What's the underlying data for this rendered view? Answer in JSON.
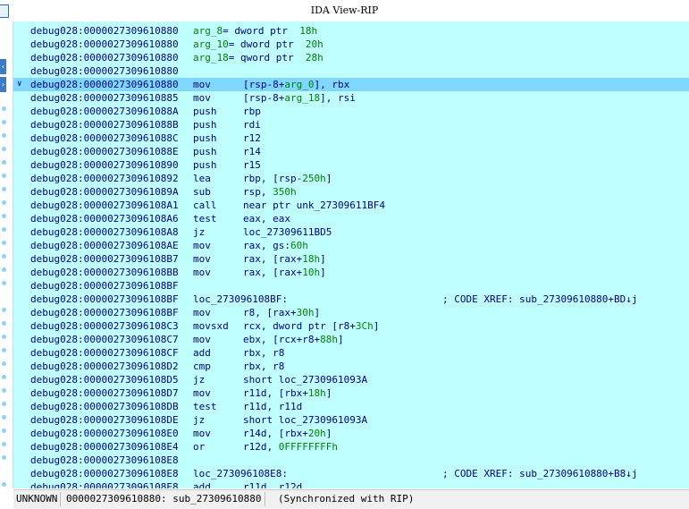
{
  "window": {
    "title": "IDA View-RIP"
  },
  "listing": {
    "rows": [
      {
        "addr": "debug028:0000027309610880",
        "kind": "var",
        "name": "arg_8",
        "eq": "= dword ptr  ",
        "val": "18h"
      },
      {
        "addr": "debug028:0000027309610880",
        "kind": "var",
        "name": "arg_10",
        "eq": "= dword ptr  ",
        "val": "20h"
      },
      {
        "addr": "debug028:0000027309610880",
        "kind": "var",
        "name": "arg_18",
        "eq": "= qword ptr  ",
        "val": "28h"
      },
      {
        "addr": "debug028:0000027309610880",
        "kind": "blank"
      },
      {
        "addr": "debug028:0000027309610880",
        "kind": "ins",
        "mnem": "mov",
        "ops": "[rsp-8+arg_0], rbx",
        "selected": true
      },
      {
        "addr": "debug028:0000027309610885",
        "kind": "ins",
        "mnem": "mov",
        "ops": "[rsp-8+arg_18], rsi"
      },
      {
        "addr": "debug028:000002730961088A",
        "kind": "ins",
        "mnem": "push",
        "ops": "rbp"
      },
      {
        "addr": "debug028:000002730961088B",
        "kind": "ins",
        "mnem": "push",
        "ops": "rdi"
      },
      {
        "addr": "debug028:000002730961088C",
        "kind": "ins",
        "mnem": "push",
        "ops": "r12"
      },
      {
        "addr": "debug028:000002730961088E",
        "kind": "ins",
        "mnem": "push",
        "ops": "r14"
      },
      {
        "addr": "debug028:0000027309610890",
        "kind": "ins",
        "mnem": "push",
        "ops": "r15"
      },
      {
        "addr": "debug028:0000027309610892",
        "kind": "ins",
        "mnem": "lea",
        "ops": "rbp, [rsp-250h]"
      },
      {
        "addr": "debug028:000002730961089A",
        "kind": "ins",
        "mnem": "sub",
        "ops": "rsp, 350h"
      },
      {
        "addr": "debug028:00000273096108A1",
        "kind": "ins",
        "mnem": "call",
        "ops": "near ptr unk_27309611BF4"
      },
      {
        "addr": "debug028:00000273096108A6",
        "kind": "ins",
        "mnem": "test",
        "ops": "eax, eax"
      },
      {
        "addr": "debug028:00000273096108A8",
        "kind": "ins",
        "mnem": "jz",
        "ops": "loc_27309611BD5"
      },
      {
        "addr": "debug028:00000273096108AE",
        "kind": "ins",
        "mnem": "mov",
        "ops": "rax, gs:60h"
      },
      {
        "addr": "debug028:00000273096108B7",
        "kind": "ins",
        "mnem": "mov",
        "ops": "rax, [rax+18h]"
      },
      {
        "addr": "debug028:00000273096108BB",
        "kind": "ins",
        "mnem": "mov",
        "ops": "rax, [rax+10h]"
      },
      {
        "addr": "debug028:00000273096108BF",
        "kind": "blank"
      },
      {
        "addr": "debug028:00000273096108BF",
        "kind": "label",
        "label": "loc_273096108BF:",
        "cmt": "; CODE XREF: sub_27309610880+BD↓j"
      },
      {
        "addr": "debug028:00000273096108BF",
        "kind": "ins",
        "mnem": "mov",
        "ops": "r8, [rax+30h]"
      },
      {
        "addr": "debug028:00000273096108C3",
        "kind": "ins",
        "mnem": "movsxd",
        "ops": "rcx, dword ptr [r8+3Ch]"
      },
      {
        "addr": "debug028:00000273096108C7",
        "kind": "ins",
        "mnem": "mov",
        "ops": "ebx, [rcx+r8+88h]"
      },
      {
        "addr": "debug028:00000273096108CF",
        "kind": "ins",
        "mnem": "add",
        "ops": "rbx, r8"
      },
      {
        "addr": "debug028:00000273096108D2",
        "kind": "ins",
        "mnem": "cmp",
        "ops": "rbx, r8"
      },
      {
        "addr": "debug028:00000273096108D5",
        "kind": "ins",
        "mnem": "jz",
        "ops": "short loc_2730961093A"
      },
      {
        "addr": "debug028:00000273096108D7",
        "kind": "ins",
        "mnem": "mov",
        "ops": "r11d, [rbx+18h]"
      },
      {
        "addr": "debug028:00000273096108DB",
        "kind": "ins",
        "mnem": "test",
        "ops": "r11d, r11d"
      },
      {
        "addr": "debug028:00000273096108DE",
        "kind": "ins",
        "mnem": "jz",
        "ops": "short loc_2730961093A"
      },
      {
        "addr": "debug028:00000273096108E0",
        "kind": "ins",
        "mnem": "mov",
        "ops": "r14d, [rbx+20h]"
      },
      {
        "addr": "debug028:00000273096108E4",
        "kind": "ins",
        "mnem": "or",
        "ops": "r12d, 0FFFFFFFFh"
      },
      {
        "addr": "debug028:00000273096108E8",
        "kind": "blank"
      },
      {
        "addr": "debug028:00000273096108E8",
        "kind": "label",
        "label": "loc_273096108E8:",
        "cmt": "; CODE XREF: sub_27309610880+B8↓j"
      },
      {
        "addr": "debug028:00000273096108E8",
        "kind": "ins",
        "mnem": "add",
        "ops": "r11d, r12d"
      }
    ]
  },
  "status": {
    "mode": "UNKNOWN",
    "location": "0000027309610880: sub_27309610880",
    "sync": "(Synchronized with RIP)"
  },
  "colors": {
    "listing_bg": "#c0ffff",
    "selected_row": "#80d7ff",
    "code_text": "#000080",
    "number_text": "#008000"
  },
  "icons": {
    "selected_row_marker": "chevron-down-icon"
  }
}
